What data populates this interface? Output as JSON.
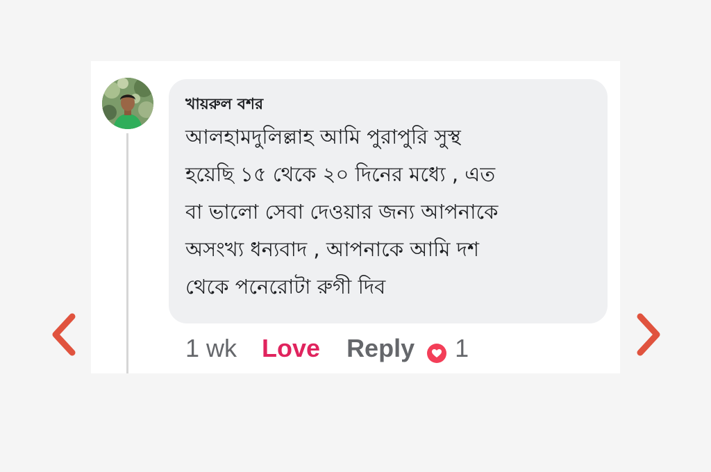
{
  "comment": {
    "author": "খায়রুল বশর",
    "text": "আলহামদুলিল্লাহ আমি পুরাপুরি সুস্থ\nহয়েছি ১৫ থেকে ২০ দিনের মধ্যে , এত\nবা ভালো সেবা দেওয়ার জন্য আপনাকে\nঅসংখ্য ধন্যবাদ , আপনাকে আমি দশ\nথেকে পনেরোটা রুগী দিব",
    "time": "1 wk",
    "love_label": "Love",
    "reply_label": "Reply",
    "reaction_icon": "heart-reaction-icon",
    "reaction_count": "1"
  },
  "navigation": {
    "prev_icon": "chevron-left-icon",
    "next_icon": "chevron-right-icon"
  },
  "colors": {
    "background": "#f5f5f5",
    "card": "#ffffff",
    "bubble": "#eff0f2",
    "love": "#e0245e",
    "reaction": "#f33e58",
    "arrow": "#e0533e",
    "meta_text": "#65676b"
  }
}
